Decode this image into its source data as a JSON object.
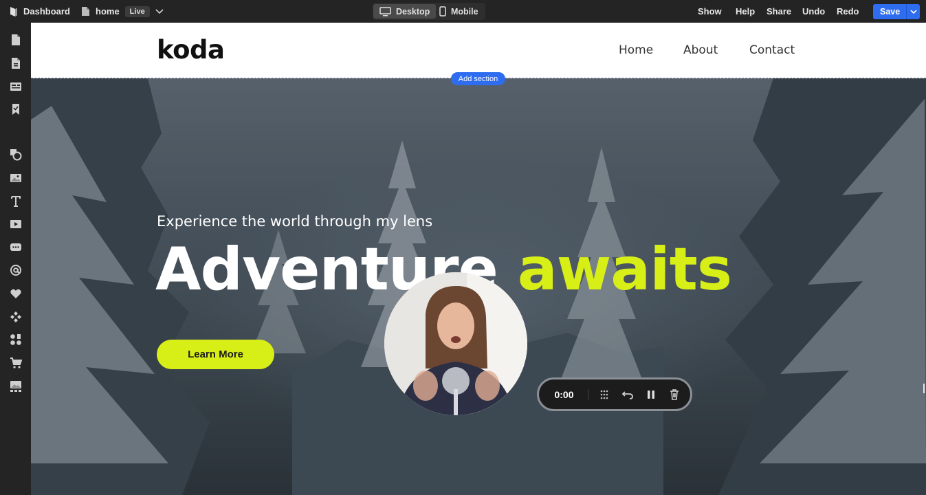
{
  "topbar": {
    "dashboard_label": "Dashboard",
    "page_name": "home",
    "live_badge": "Live",
    "device_desktop": "Desktop",
    "device_mobile": "Mobile",
    "show": "Show",
    "help": "Help",
    "share": "Share",
    "undo": "Undo",
    "redo": "Redo",
    "save": "Save"
  },
  "leftbar": {
    "tools": [
      "pages-icon",
      "page-settings-icon",
      "sections-icon",
      "bookmark-icon",
      "shapes-icon",
      "image-icon",
      "text-icon",
      "video-icon",
      "chat-icon",
      "email-icon",
      "heart-icon",
      "apps-icon",
      "widgets-icon",
      "cart-icon",
      "gallery-icon"
    ]
  },
  "site": {
    "logo": "koda",
    "nav": [
      "Home",
      "About",
      "Contact"
    ],
    "add_section": "Add section",
    "hero_subtitle": "Experience the world through my lens",
    "hero_title_main": "Adventure",
    "hero_title_accent": "awaits",
    "cta": "Learn More",
    "accent_color": "#d8ef17"
  },
  "recorder": {
    "time": "0:00"
  },
  "colors": {
    "primary_blue": "#2f6df0",
    "toolbar_bg": "#242424"
  }
}
